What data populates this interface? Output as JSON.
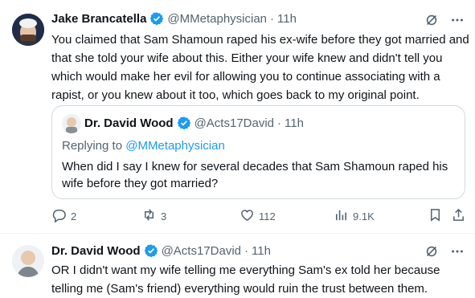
{
  "colors": {
    "accent": "#1d9bf0",
    "muted": "#536471",
    "text": "#0f1419",
    "border": "#cfd9de"
  },
  "tweet1": {
    "name": "Jake Brancatella",
    "handle": "@MMetaphysician",
    "dot": "·",
    "time": "11h",
    "text": "You claimed that Sam Shamoun raped his ex-wife before they got married and that she told your wife about this. Either your wife knew and didn't tell you which would make her evil for allowing you to continue associating with a rapist, or you knew about it too, which goes back to my original point.",
    "quote": {
      "name": "Dr. David Wood",
      "handle": "@Acts17David",
      "dot": "·",
      "time": "11h",
      "replying_prefix": "Replying to ",
      "replying_to": "@MMetaphysician",
      "text": "When did I say I knew for several decades that Sam Shamoun raped his wife before they got married?"
    },
    "actions": {
      "replies": "2",
      "retweets": "3",
      "likes": "112",
      "views": "9.1K"
    }
  },
  "tweet2": {
    "name": "Dr. David Wood",
    "handle": "@Acts17David",
    "dot": "·",
    "time": "11h",
    "text": "OR I didn't want my wife telling me everything Sam's ex told her because telling me (Sam's friend) everything would ruin the trust between them."
  },
  "icons": [
    "verified-badge-icon",
    "grok-icon",
    "more-icon",
    "reply-icon",
    "retweet-icon",
    "like-icon",
    "views-icon",
    "bookmark-icon",
    "share-icon"
  ]
}
